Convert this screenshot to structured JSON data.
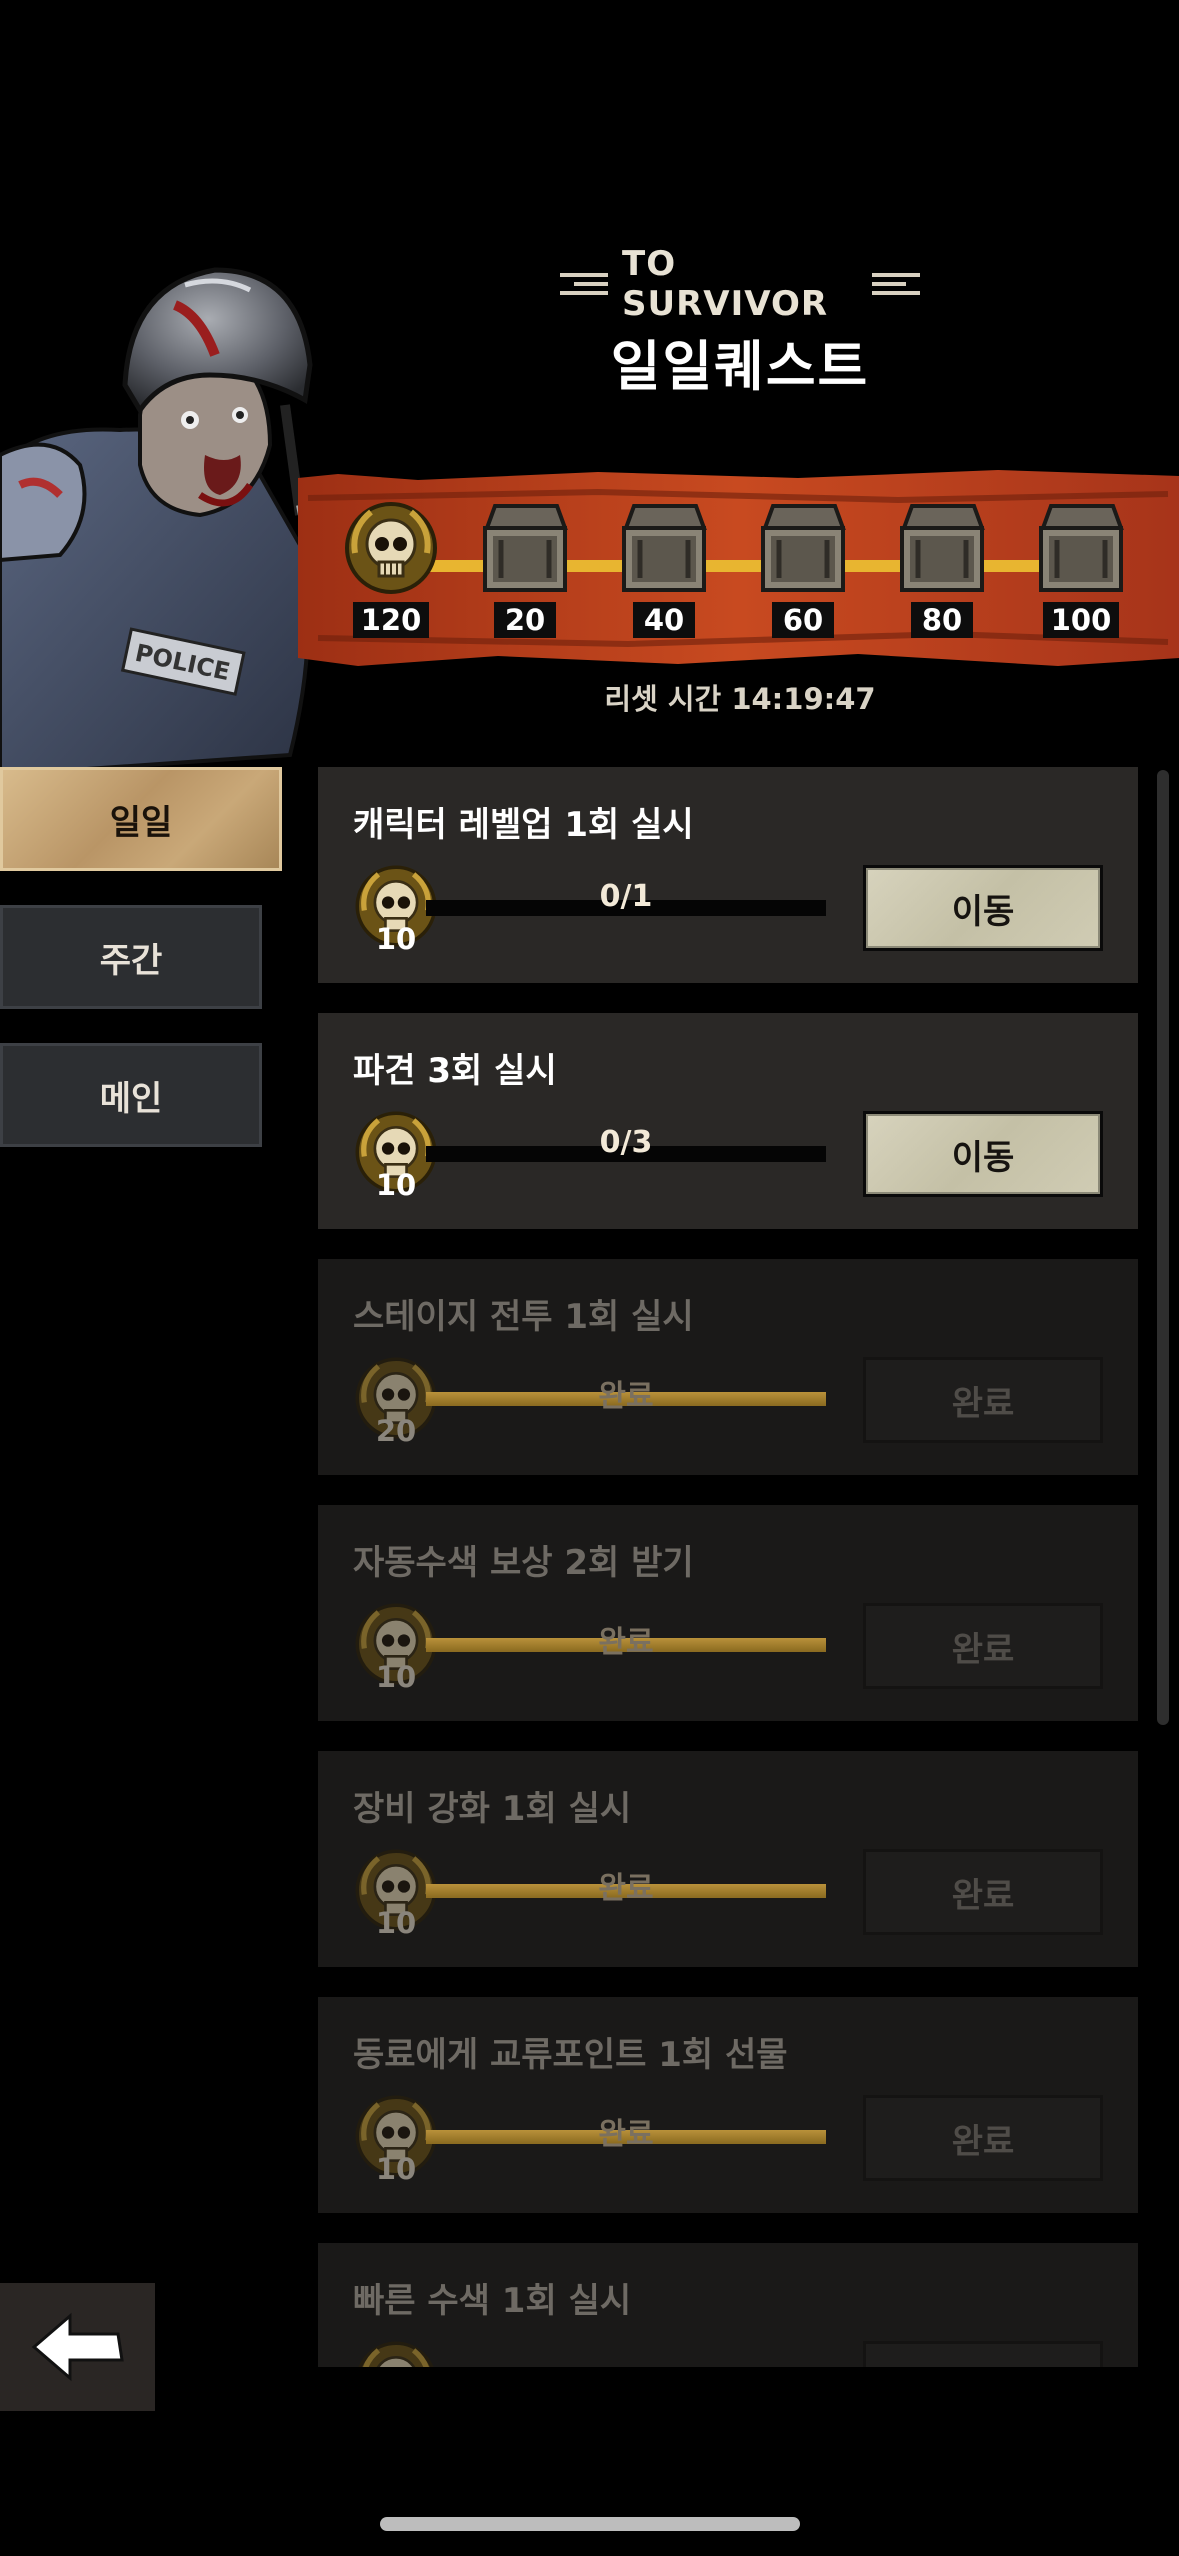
{
  "header": {
    "subtitle": "TO SURVIVOR",
    "title": "일일퀘스트"
  },
  "rewards": {
    "milestones": [
      {
        "label": "120",
        "icon": "skull-medal-icon"
      },
      {
        "label": "20",
        "icon": "chest-icon"
      },
      {
        "label": "40",
        "icon": "chest-icon"
      },
      {
        "label": "60",
        "icon": "chest-icon"
      },
      {
        "label": "80",
        "icon": "chest-icon"
      },
      {
        "label": "100",
        "icon": "chest-icon"
      }
    ],
    "reset_text": "리셋 시간 14:19:47"
  },
  "tabs": {
    "daily": "일일",
    "weekly": "주간",
    "main": "메인"
  },
  "quests": [
    {
      "title": "캐릭터 레벨업 1회 실시",
      "points": "10",
      "progress": "0/1",
      "button": "이동",
      "state": "go"
    },
    {
      "title": "파견 3회 실시",
      "points": "10",
      "progress": "0/3",
      "button": "이동",
      "state": "go"
    },
    {
      "title": "스테이지 전투 1회 실시",
      "points": "20",
      "progress": "완료",
      "button": "완료",
      "state": "complete"
    },
    {
      "title": "자동수색 보상 2회 받기",
      "points": "10",
      "progress": "완료",
      "button": "완료",
      "state": "complete"
    },
    {
      "title": "장비 강화 1회 실시",
      "points": "10",
      "progress": "완료",
      "button": "완료",
      "state": "complete"
    },
    {
      "title": "동료에게 교류포인트 1회 선물",
      "points": "10",
      "progress": "완료",
      "button": "완료",
      "state": "complete"
    },
    {
      "title": "빠른 수색 1회 실시",
      "points": "",
      "progress": "",
      "button": "",
      "state": "complete"
    }
  ],
  "colors": {
    "banner_orange": "#c2421c",
    "track_yellow": "#e8b530",
    "button_go": "#cdc9b0",
    "card_active": "#2a2826",
    "card_done": "#1a1918"
  }
}
